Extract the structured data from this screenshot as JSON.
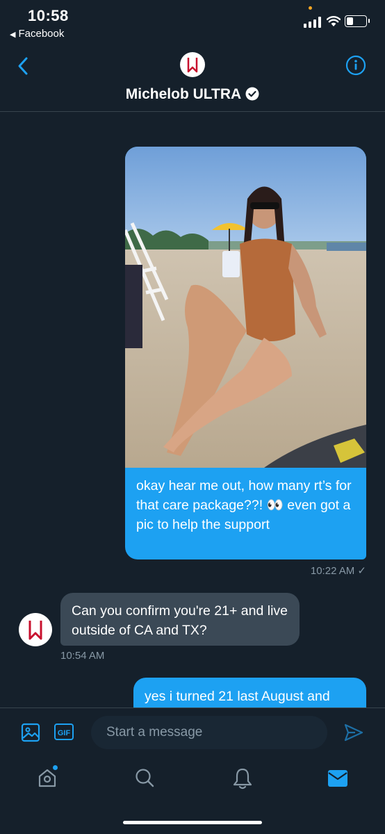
{
  "status_bar": {
    "time": "10:58",
    "back_app": "Facebook"
  },
  "header": {
    "title": "Michelob ULTRA",
    "verified": true
  },
  "messages": [
    {
      "direction": "outgoing",
      "has_photo": true,
      "text": "okay hear me out, how many rt’s for that care package??! 👀 even got a pic to help the support",
      "time": "10:22 AM ✓"
    },
    {
      "direction": "incoming",
      "text": "Can you confirm you're 21+ and live outside of CA and TX?",
      "time": "10:54 AM"
    },
    {
      "direction": "outgoing",
      "text": "yes i turned 21 last August and"
    }
  ],
  "composer": {
    "placeholder": "Start a message",
    "gif_label": "GIF"
  },
  "tabs": [
    "home-icon",
    "search-icon",
    "bell-icon",
    "mail-icon"
  ],
  "colors": {
    "background": "#15202b",
    "accent": "#1da1f2",
    "incoming_bubble": "#3b4956",
    "muted_text": "#8899a6"
  }
}
